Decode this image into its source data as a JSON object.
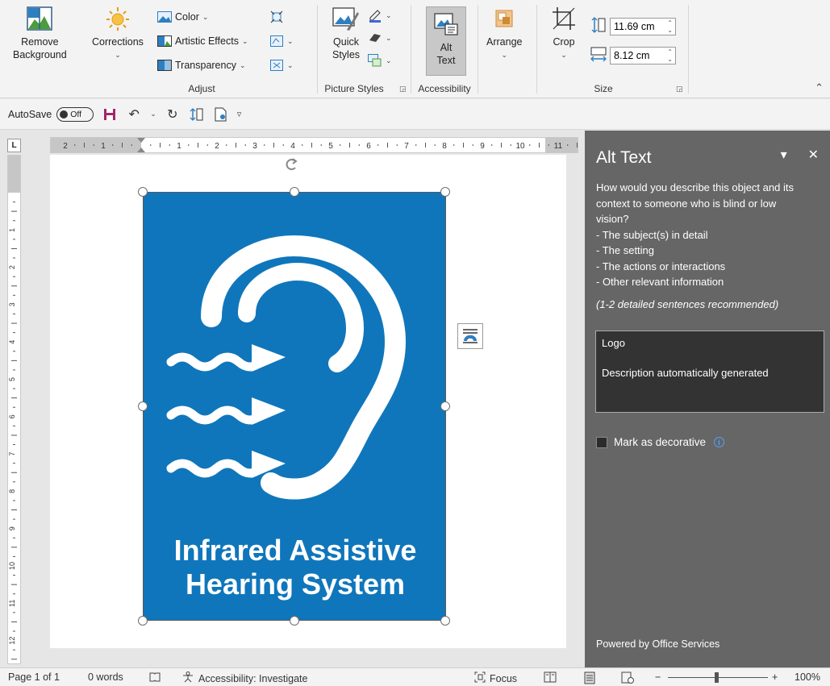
{
  "ribbon": {
    "remove_background": {
      "line1": "Remove",
      "line2": "Background"
    },
    "corrections": {
      "label": "Corrections"
    },
    "color": {
      "label": "Color"
    },
    "artistic_effects": {
      "label": "Artistic Effects"
    },
    "transparency": {
      "label": "Transparency"
    },
    "adjust_group": "Adjust",
    "quick_styles": {
      "line1": "Quick",
      "line2": "Styles"
    },
    "picture_styles_group": "Picture Styles",
    "alt_text": {
      "line1": "Alt",
      "line2": "Text"
    },
    "accessibility_group": "Accessibility",
    "arrange": {
      "label": "Arrange"
    },
    "crop": {
      "label": "Crop"
    },
    "height_value": "11.69 cm",
    "width_value": "8.12 cm",
    "size_group": "Size"
  },
  "qat": {
    "autosave_label": "AutoSave",
    "autosave_state": "Off"
  },
  "ruler": {
    "h_labels": [
      "2",
      "1",
      "1",
      "2",
      "3",
      "4",
      "5",
      "6",
      "7",
      "8",
      "9",
      "10",
      "11"
    ],
    "v_labels": [
      "1",
      "2",
      "3",
      "4",
      "5",
      "6",
      "7",
      "8",
      "9",
      "10",
      "11",
      "12"
    ]
  },
  "picture": {
    "title_line1": "Infrared Assistive",
    "title_line2": "Hearing System",
    "bg_color": "#0f76bb"
  },
  "alt_pane": {
    "title": "Alt Text",
    "description_lines": [
      "How would you describe this object and its",
      "context to someone who is blind or low",
      "vision?",
      "- The subject(s) in detail",
      "- The setting",
      "- The actions or interactions",
      "- Other relevant information"
    ],
    "recommendation": "(1-2 detailed sentences recommended)",
    "alt_text_line1": "Logo",
    "alt_text_line2": "Description automatically generated",
    "decorative_label": "Mark as decorative",
    "powered_by": "Powered by Office Services"
  },
  "status": {
    "page": "Page 1 of 1",
    "words": "0 words",
    "accessibility": "Accessibility: Investigate",
    "focus": "Focus",
    "zoom": "100%",
    "zoom_minus": "−",
    "zoom_plus": "+"
  }
}
